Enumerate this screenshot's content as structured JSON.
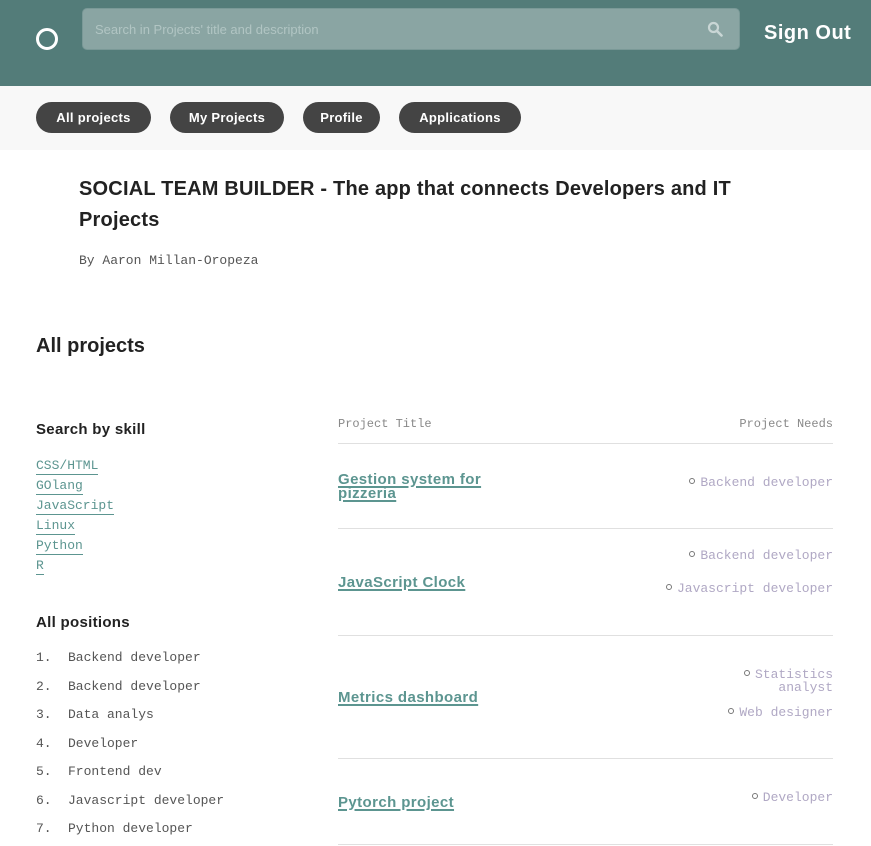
{
  "header": {
    "search_placeholder": "Search in Projects' title and description",
    "search_value": "",
    "sign_out_label": "Sign Out",
    "brand_color": "#537c79"
  },
  "nav": {
    "tabs": [
      {
        "label": "All projects"
      },
      {
        "label": "My Projects"
      },
      {
        "label": "Profile"
      },
      {
        "label": "Applications"
      }
    ]
  },
  "intro": {
    "title": "SOCIAL TEAM BUILDER - The app that connects Developers and IT Projects",
    "byline": "By Aaron Millan-Oropeza"
  },
  "main": {
    "section_title": "All projects",
    "sidebar": {
      "skills_heading": "Search by skill",
      "skills": [
        "CSS/HTML",
        "GOlang",
        "JavaScript",
        "Linux",
        "Python",
        "R"
      ],
      "positions_heading": "All positions",
      "positions": [
        {
          "num": "1.",
          "label": "Backend developer"
        },
        {
          "num": "2.",
          "label": "Backend developer"
        },
        {
          "num": "3.",
          "label": "Data analys"
        },
        {
          "num": "4.",
          "label": "Developer"
        },
        {
          "num": "5.",
          "label": "Frontend dev"
        },
        {
          "num": "6.",
          "label": "Javascript developer"
        },
        {
          "num": "7.",
          "label": "Python developer"
        }
      ]
    },
    "table": {
      "col_title": "Project Title",
      "col_needs": "Project Needs",
      "projects": [
        {
          "title": "Gestion system for pizzeria",
          "needs": [
            "Backend developer"
          ]
        },
        {
          "title": "JavaScript Clock",
          "needs": [
            "Backend developer",
            "Javascript developer"
          ]
        },
        {
          "title": "Metrics dashboard",
          "needs": [
            "Statistics analyst",
            "Web designer"
          ]
        },
        {
          "title": "Pytorch project",
          "needs": [
            "Developer"
          ]
        }
      ]
    }
  }
}
